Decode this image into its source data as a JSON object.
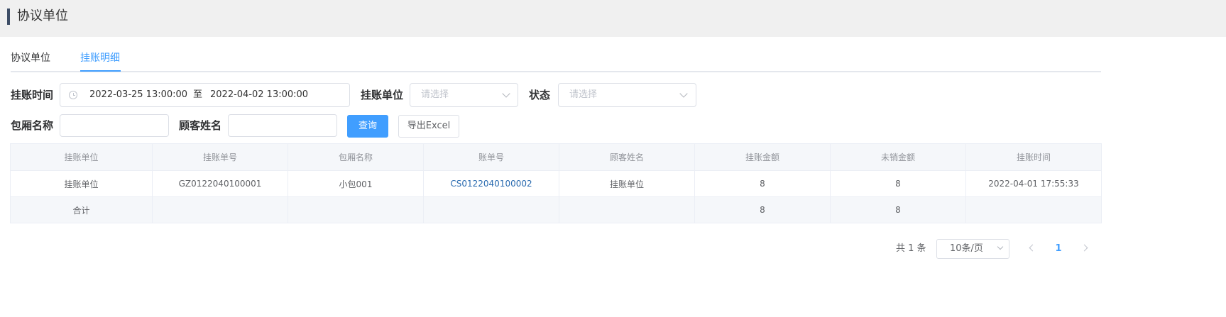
{
  "header": {
    "title": "协议单位"
  },
  "tabs": [
    {
      "label": "协议单位"
    },
    {
      "label": "挂账明细"
    }
  ],
  "active_tab": "挂账明细",
  "filters": {
    "time_label": "挂账时间",
    "date_start": "2022-03-25 13:00:00",
    "date_sep": "至",
    "date_end": "2022-04-02 13:00:00",
    "unit_label": "挂账单位",
    "unit_placeholder": "请选择",
    "status_label": "状态",
    "status_placeholder": "请选择",
    "room_label": "包厢名称",
    "room_value": "",
    "customer_label": "顾客姓名",
    "customer_value": "",
    "query_button": "查询",
    "export_button": "导出Excel"
  },
  "table": {
    "columns": [
      "挂账单位",
      "挂账单号",
      "包厢名称",
      "账单号",
      "顾客姓名",
      "挂账金额",
      "未销金额",
      "挂账时间"
    ],
    "rows": [
      [
        "挂账单位",
        "GZ0122040100001",
        "小包001",
        "CS0122040100002",
        "挂账单位",
        "8",
        "8",
        "2022-04-01 17:55:33"
      ]
    ],
    "summary": [
      "合计",
      "",
      "",
      "",
      "",
      "8",
      "8",
      ""
    ]
  },
  "pagination": {
    "total_text": "共 1 条",
    "page_size": "10条/页",
    "current_page": "1"
  },
  "colors": {
    "accent": "#409eff",
    "link": "#2a6bb0",
    "header_bg": "#f0f0f0"
  }
}
